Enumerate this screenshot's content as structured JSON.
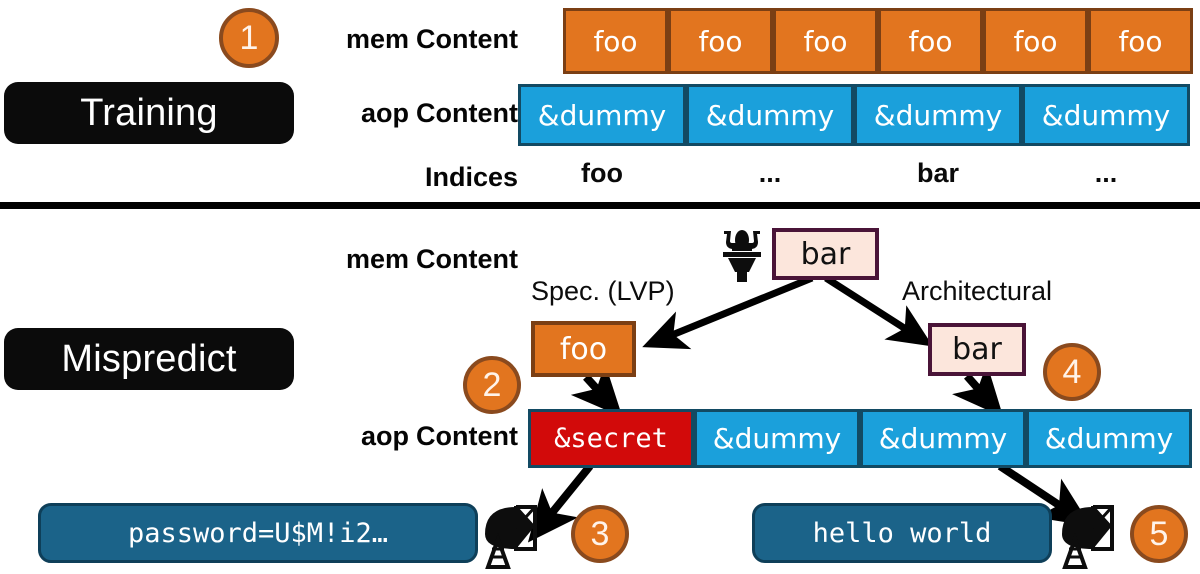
{
  "diagram": {
    "title": "Speculative load value prediction leak diagram",
    "colors": {
      "orange": "#E2751F",
      "orange_border": "#7B3F14",
      "blue": "#1BA0DB",
      "blue_border": "#124A63",
      "red": "#D20A0A",
      "arch_fill": "#FCE6DC",
      "arch_border": "#4A1438",
      "terminal": "#1B6389",
      "black": "#0B0B0B"
    }
  },
  "training": {
    "phase_label": "Training",
    "badge": "1",
    "rows": {
      "mem_label_prefix": "mem",
      "mem_label_suffix": "Content",
      "aop_label_prefix": "aop",
      "aop_label_suffix": "Content",
      "indices_label": "Indices"
    },
    "mem_cells": [
      "foo",
      "foo",
      "foo",
      "foo",
      "foo",
      "foo"
    ],
    "aop_cells": [
      "&dummy",
      "&dummy",
      "&dummy",
      "&dummy"
    ],
    "indices": [
      "foo",
      "...",
      "bar",
      "..."
    ]
  },
  "mispredict": {
    "phase_label": "Mispredict",
    "rows": {
      "mem_label_prefix": "mem",
      "mem_label_suffix": "Content",
      "aop_label_prefix": "aop",
      "aop_label_suffix": "Content"
    },
    "badges": {
      "spec": "2",
      "leak": "3",
      "arch": "4",
      "arch_leak": "5"
    },
    "captions": {
      "spec": "Spec. (LVP)",
      "arch": "Architectural"
    },
    "source_value": "bar",
    "spec_value": "foo",
    "arch_value": "bar",
    "aop_cells": [
      "&secret",
      "&dummy",
      "&dummy",
      "&dummy"
    ],
    "leak_secret_text": "password=U$M!i2…",
    "leak_normal_text": "hello world",
    "icons": {
      "flush": "toilet-flush-icon",
      "secret_transmit": "satellite-dish-icon",
      "normal_transmit": "satellite-dish-icon"
    }
  }
}
